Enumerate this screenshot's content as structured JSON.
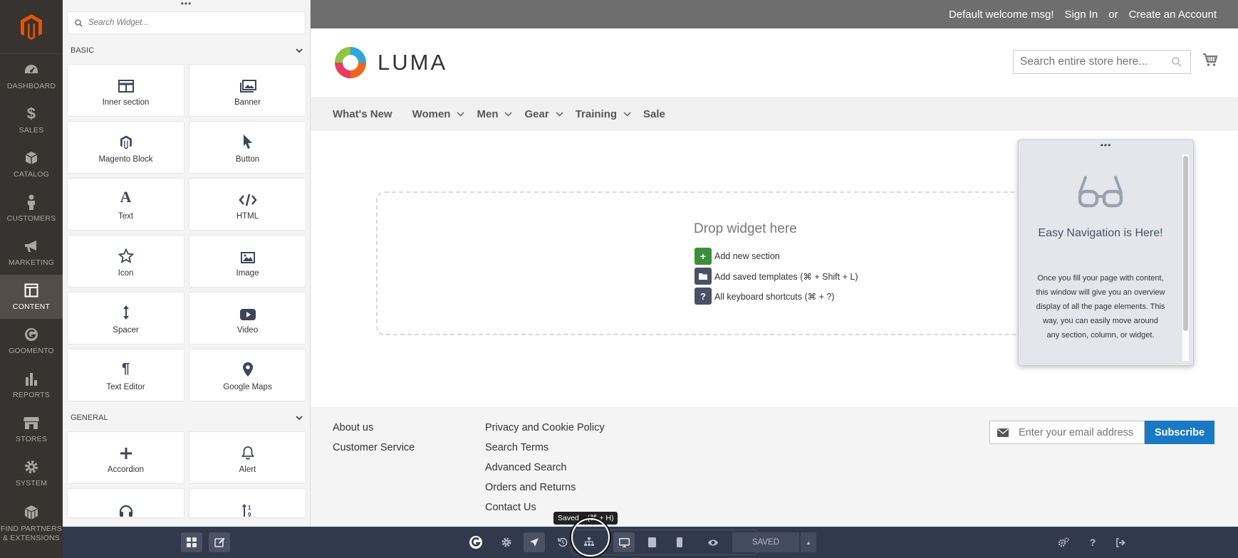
{
  "admin_nav": {
    "items": [
      {
        "label": "DASHBOARD",
        "icon": "dashboard-icon"
      },
      {
        "label": "SALES",
        "icon": "dollar-icon"
      },
      {
        "label": "CATALOG",
        "icon": "cube-icon"
      },
      {
        "label": "CUSTOMERS",
        "icon": "person-icon"
      },
      {
        "label": "MARKETING",
        "icon": "megaphone-icon"
      },
      {
        "label": "CONTENT",
        "icon": "layout-icon",
        "active": true
      },
      {
        "label": "GOOMENTO",
        "icon": "goomento-icon"
      },
      {
        "label": "REPORTS",
        "icon": "bar-chart-icon"
      },
      {
        "label": "STORES",
        "icon": "store-icon"
      },
      {
        "label": "SYSTEM",
        "icon": "gear-icon"
      },
      {
        "label": "FIND PARTNERS & EXTENSIONS",
        "icon": "boxes-icon"
      }
    ]
  },
  "widget_panel": {
    "search_placeholder": "Search Widget...",
    "basic": {
      "title": "BASIC",
      "widgets": [
        "Inner section",
        "Banner",
        "Magento Block",
        "Button",
        "Text",
        "HTML",
        "Icon",
        "Image",
        "Spacer",
        "Video",
        "Text Editor",
        "Google Maps"
      ]
    },
    "general": {
      "title": "GENERAL",
      "widgets": [
        "Accordion",
        "Alert"
      ]
    }
  },
  "store": {
    "topbar": {
      "welcome": "Default welcome msg!",
      "sign_in": "Sign In",
      "or": "or",
      "create_account": "Create an Account"
    },
    "logo_text": "LUMA",
    "search_placeholder": "Search entire store here...",
    "menu": [
      {
        "label": "What's New",
        "dropdown": false
      },
      {
        "label": "Women",
        "dropdown": true
      },
      {
        "label": "Men",
        "dropdown": true
      },
      {
        "label": "Gear",
        "dropdown": true
      },
      {
        "label": "Training",
        "dropdown": true
      },
      {
        "label": "Sale",
        "dropdown": false
      }
    ],
    "dropzone": {
      "title": "Drop widget here",
      "actions": [
        {
          "label": "Add new section",
          "color": "#3b8f3b"
        },
        {
          "label": "Add saved templates (⌘ + Shift + L)",
          "color": "#4a5164"
        },
        {
          "label": "All keyboard shortcuts (⌘ + ?)",
          "color": "#4a5164"
        }
      ]
    },
    "navigator": {
      "title": "Easy Navigation is Here!",
      "body": "Once you fill your page with content, this window will give you an overview display of all the page elements. This way, you can easily move around any section, column, or widget."
    },
    "footer": {
      "col1": [
        "About us",
        "Customer Service"
      ],
      "col2": [
        "Privacy and Cookie Policy",
        "Search Terms",
        "Advanced Search",
        "Orders and Returns",
        "Contact Us"
      ],
      "newsletter_placeholder": "Enter your email address",
      "subscribe_label": "Subscribe"
    }
  },
  "toolbar": {
    "saved_label": "SAVED",
    "tooltip": "Saved ...(⌘ + H)"
  },
  "colors": {
    "admin_bg": "#373330",
    "magento_orange": "#eb5202",
    "toolbar_bg": "#313a4d",
    "subscribe_blue": "#1979c3"
  }
}
